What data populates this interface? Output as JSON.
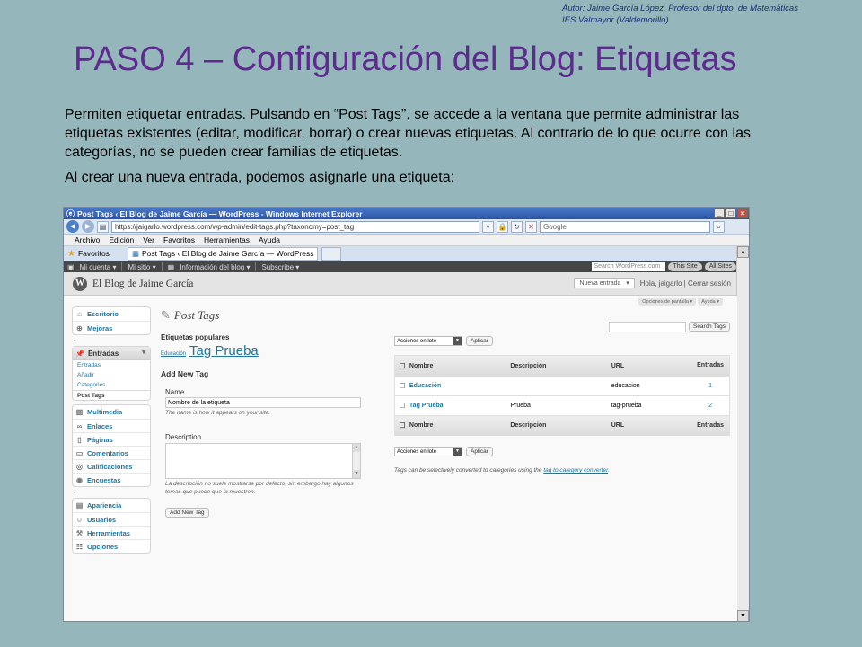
{
  "slide": {
    "author_line1": "Autor: Jaime García López. Profesor del dpto. de Matemáticas",
    "author_line2": "IES Valmayor (Valdemorillo)",
    "title": "PASO 4 – Configuración del Blog: Etiquetas",
    "paragraph1": "Permiten etiquetar entradas. Pulsando en “Post Tags”, se accede a la ventana que permite administrar las etiquetas existentes (editar, modificar, borrar) o crear nuevas etiquetas. Al contrario de lo que ocurre con las categorías, no se pueden crear familias de etiquetas.",
    "paragraph2": "Al crear una nueva entrada, podemos asignarle una etiqueta:"
  },
  "browser": {
    "window_title": "Post Tags ‹ El Blog de Jaime García — WordPress - Windows Internet Explorer",
    "url": "https://jaigarlo.wordpress.com/wp-admin/edit-tags.php?taxonomy=post_tag",
    "search_placeholder": "Google",
    "menu": [
      "Archivo",
      "Edición",
      "Ver",
      "Favoritos",
      "Herramientas",
      "Ayuda"
    ],
    "favorites_label": "Favoritos",
    "tab_label": "Post Tags ‹ El Blog de Jaime García — WordPress"
  },
  "admin_bar": {
    "items": [
      "Mi cuenta ▾",
      "Mi sitio ▾",
      "Información del blog ▾",
      "Subscribe ▾"
    ],
    "search_placeholder": "Search WordPress.com",
    "this_site": "This Site",
    "all_sites": "All Sites"
  },
  "header": {
    "blog_name": "El Blog de Jaime García",
    "new_entry": "Nueva entrada",
    "greeting": "Hola, jaigarlo | Cerrar sesión",
    "screen_options": "Opciones de pantalla ▾",
    "help": "Ayuda ▾"
  },
  "sidebar": {
    "group1": [
      "Escritorio",
      "Mejoras"
    ],
    "entries_head": "Entradas",
    "entries_sub": [
      "Entradas",
      "Añadir",
      "Categories",
      "Post Tags"
    ],
    "group2": [
      "Multimedia",
      "Enlaces",
      "Páginas",
      "Comentarios",
      "Calificaciones",
      "Encuestas"
    ],
    "group3": [
      "Apariencia",
      "Usuarios",
      "Herramientas",
      "Opciones"
    ]
  },
  "page": {
    "title": "Post Tags",
    "popular_heading": "Etiquetas populares",
    "popular_tags": [
      "Educación",
      "Tag Prueba"
    ],
    "add_heading": "Add New Tag",
    "name_label": "Name",
    "name_value": "Nombre de la etiqueta",
    "name_hint": "The name is how it appears on your site.",
    "desc_label": "Description",
    "desc_hint": "La descripción no suele mostrarse por defecto, sin embargo hay algunos temas que puede que la muestren.",
    "add_button": "Add New Tag",
    "search_button": "Search Tags",
    "bulk_label": "Acciones en lote",
    "apply_button": "Aplicar",
    "columns": [
      "Nombre",
      "Descripción",
      "URL",
      "Entradas"
    ],
    "rows": [
      {
        "name": "Educación",
        "desc": "",
        "url": "educacion",
        "count": "1"
      },
      {
        "name": "Tag Prueba",
        "desc": "Prueba",
        "url": "tag-prueba",
        "count": "2"
      }
    ],
    "note_prefix": "Tags can be selectively converted to categories using the",
    "note_link": "tag to category converter",
    "note_suffix": "."
  }
}
